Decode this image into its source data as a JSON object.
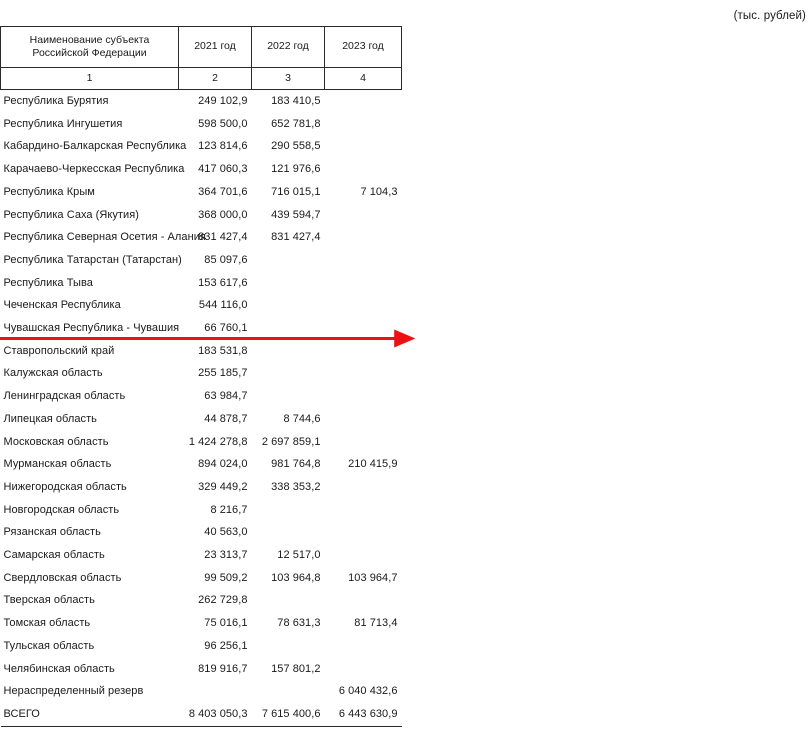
{
  "units_caption": "(тыс. рублей)",
  "table": {
    "columns": [
      {
        "label": "Наименование субъекта Российской Федерации",
        "number": "1"
      },
      {
        "label": "2021 год",
        "number": "2"
      },
      {
        "label": "2022 год",
        "number": "3"
      },
      {
        "label": "2023 год",
        "number": "4"
      }
    ],
    "rows": [
      {
        "name": "Республика Бурятия",
        "y2021": "249 102,9",
        "y2022": "183 410,5",
        "y2023": ""
      },
      {
        "name": "Республика Ингушетия",
        "y2021": "598 500,0",
        "y2022": "652 781,8",
        "y2023": ""
      },
      {
        "name": "Кабардино-Балкарская Республика",
        "y2021": "123 814,6",
        "y2022": "290 558,5",
        "y2023": ""
      },
      {
        "name": "Карачаево-Черкесская Республика",
        "y2021": "417 060,3",
        "y2022": "121 976,6",
        "y2023": ""
      },
      {
        "name": "Республика Крым",
        "y2021": "364 701,6",
        "y2022": "716 015,1",
        "y2023": "7 104,3"
      },
      {
        "name": "Республика Саха (Якутия)",
        "y2021": "368 000,0",
        "y2022": "439 594,7",
        "y2023": ""
      },
      {
        "name": "Республика Северная Осетия - Алания",
        "y2021": "831 427,4",
        "y2022": "831 427,4",
        "y2023": ""
      },
      {
        "name": "Республика Татарстан (Татарстан)",
        "y2021": "85 097,6",
        "y2022": "",
        "y2023": ""
      },
      {
        "name": "Республика Тыва",
        "y2021": "153 617,6",
        "y2022": "",
        "y2023": ""
      },
      {
        "name": "Чеченская Республика",
        "y2021": "544 116,0",
        "y2022": "",
        "y2023": ""
      },
      {
        "name": "Чувашская Республика - Чувашия",
        "y2021": "66 760,1",
        "y2022": "",
        "y2023": ""
      },
      {
        "name": "Ставропольский край",
        "y2021": "183 531,8",
        "y2022": "",
        "y2023": ""
      },
      {
        "name": "Калужская область",
        "y2021": "255 185,7",
        "y2022": "",
        "y2023": ""
      },
      {
        "name": "Ленинградская область",
        "y2021": "63 984,7",
        "y2022": "",
        "y2023": ""
      },
      {
        "name": "Липецкая область",
        "y2021": "44 878,7",
        "y2022": "8 744,6",
        "y2023": ""
      },
      {
        "name": "Московская область",
        "y2021": "1 424 278,8",
        "y2022": "2 697 859,1",
        "y2023": ""
      },
      {
        "name": "Мурманская область",
        "y2021": "894 024,0",
        "y2022": "981 764,8",
        "y2023": "210 415,9"
      },
      {
        "name": "Нижегородская область",
        "y2021": "329 449,2",
        "y2022": "338 353,2",
        "y2023": ""
      },
      {
        "name": "Новгородская область",
        "y2021": "8 216,7",
        "y2022": "",
        "y2023": ""
      },
      {
        "name": "Рязанская область",
        "y2021": "40 563,0",
        "y2022": "",
        "y2023": ""
      },
      {
        "name": "Самарская область",
        "y2021": "23 313,7",
        "y2022": "12 517,0",
        "y2023": ""
      },
      {
        "name": "Свердловская область",
        "y2021": "99 509,2",
        "y2022": "103 964,8",
        "y2023": "103 964,7"
      },
      {
        "name": "Тверская область",
        "y2021": "262 729,8",
        "y2022": "",
        "y2023": ""
      },
      {
        "name": "Томская область",
        "y2021": "75 016,1",
        "y2022": "78 631,3",
        "y2023": "81 713,4"
      },
      {
        "name": "Тульская область",
        "y2021": "96 256,1",
        "y2022": "",
        "y2023": ""
      },
      {
        "name": "Челябинская область",
        "y2021": "819 916,7",
        "y2022": "157 801,2",
        "y2023": ""
      },
      {
        "name": "Нераспределенный резерв",
        "y2021": "",
        "y2022": "",
        "y2023": "6 040 432,6"
      },
      {
        "name": "ВСЕГО",
        "y2021": "8 403 050,3",
        "y2022": "7 615 400,6",
        "y2023": "6 443 630,9"
      }
    ],
    "total_row_index": 27
  },
  "annotation": {
    "arrow_color": "#ee1111",
    "arrow_name": "red-pointer-arrow"
  }
}
